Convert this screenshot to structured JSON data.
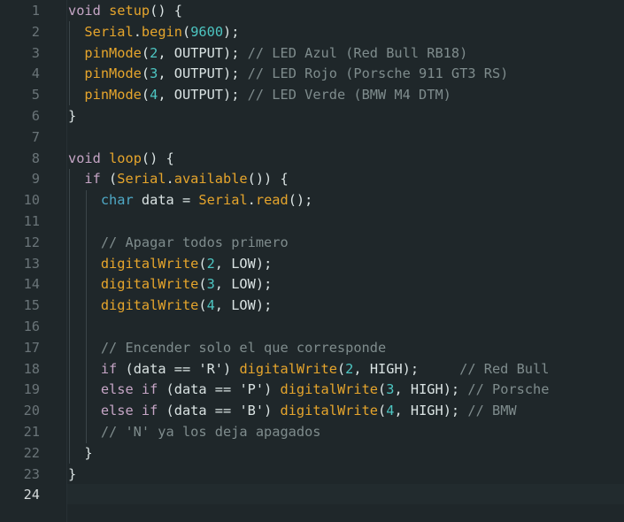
{
  "editor": {
    "language": "Arduino C++",
    "active_line": 24,
    "lines": [
      {
        "n": "1",
        "text": "void setup() {"
      },
      {
        "n": "2",
        "text": "  Serial.begin(9600);"
      },
      {
        "n": "3",
        "text": "  pinMode(2, OUTPUT); // LED Azul (Red Bull RB18)"
      },
      {
        "n": "4",
        "text": "  pinMode(3, OUTPUT); // LED Rojo (Porsche 911 GT3 RS)"
      },
      {
        "n": "5",
        "text": "  pinMode(4, OUTPUT); // LED Verde (BMW M4 DTM)"
      },
      {
        "n": "6",
        "text": "}"
      },
      {
        "n": "7",
        "text": ""
      },
      {
        "n": "8",
        "text": "void loop() {"
      },
      {
        "n": "9",
        "text": "  if (Serial.available()) {"
      },
      {
        "n": "10",
        "text": "    char data = Serial.read();"
      },
      {
        "n": "11",
        "text": ""
      },
      {
        "n": "12",
        "text": "    // Apagar todos primero"
      },
      {
        "n": "13",
        "text": "    digitalWrite(2, LOW);"
      },
      {
        "n": "14",
        "text": "    digitalWrite(3, LOW);"
      },
      {
        "n": "15",
        "text": "    digitalWrite(4, LOW);"
      },
      {
        "n": "16",
        "text": ""
      },
      {
        "n": "17",
        "text": "    // Encender solo el que corresponde"
      },
      {
        "n": "18",
        "text": "    if (data == 'R') digitalWrite(2, HIGH);     // Red Bull"
      },
      {
        "n": "19",
        "text": "    else if (data == 'P') digitalWrite(3, HIGH); // Porsche"
      },
      {
        "n": "20",
        "text": "    else if (data == 'B') digitalWrite(4, HIGH); // BMW"
      },
      {
        "n": "21",
        "text": "    // 'N' ya los deja apagados"
      },
      {
        "n": "22",
        "text": "  }"
      },
      {
        "n": "23",
        "text": "}"
      },
      {
        "n": "24",
        "text": ""
      }
    ]
  },
  "theme": {
    "background": "#1f272a",
    "keyword": "#c5a5c5",
    "function": "#e6a52c",
    "type": "#4fa9c6",
    "number": "#4dc6c2",
    "comment": "#7f8c8d",
    "text": "#dae3e3"
  }
}
